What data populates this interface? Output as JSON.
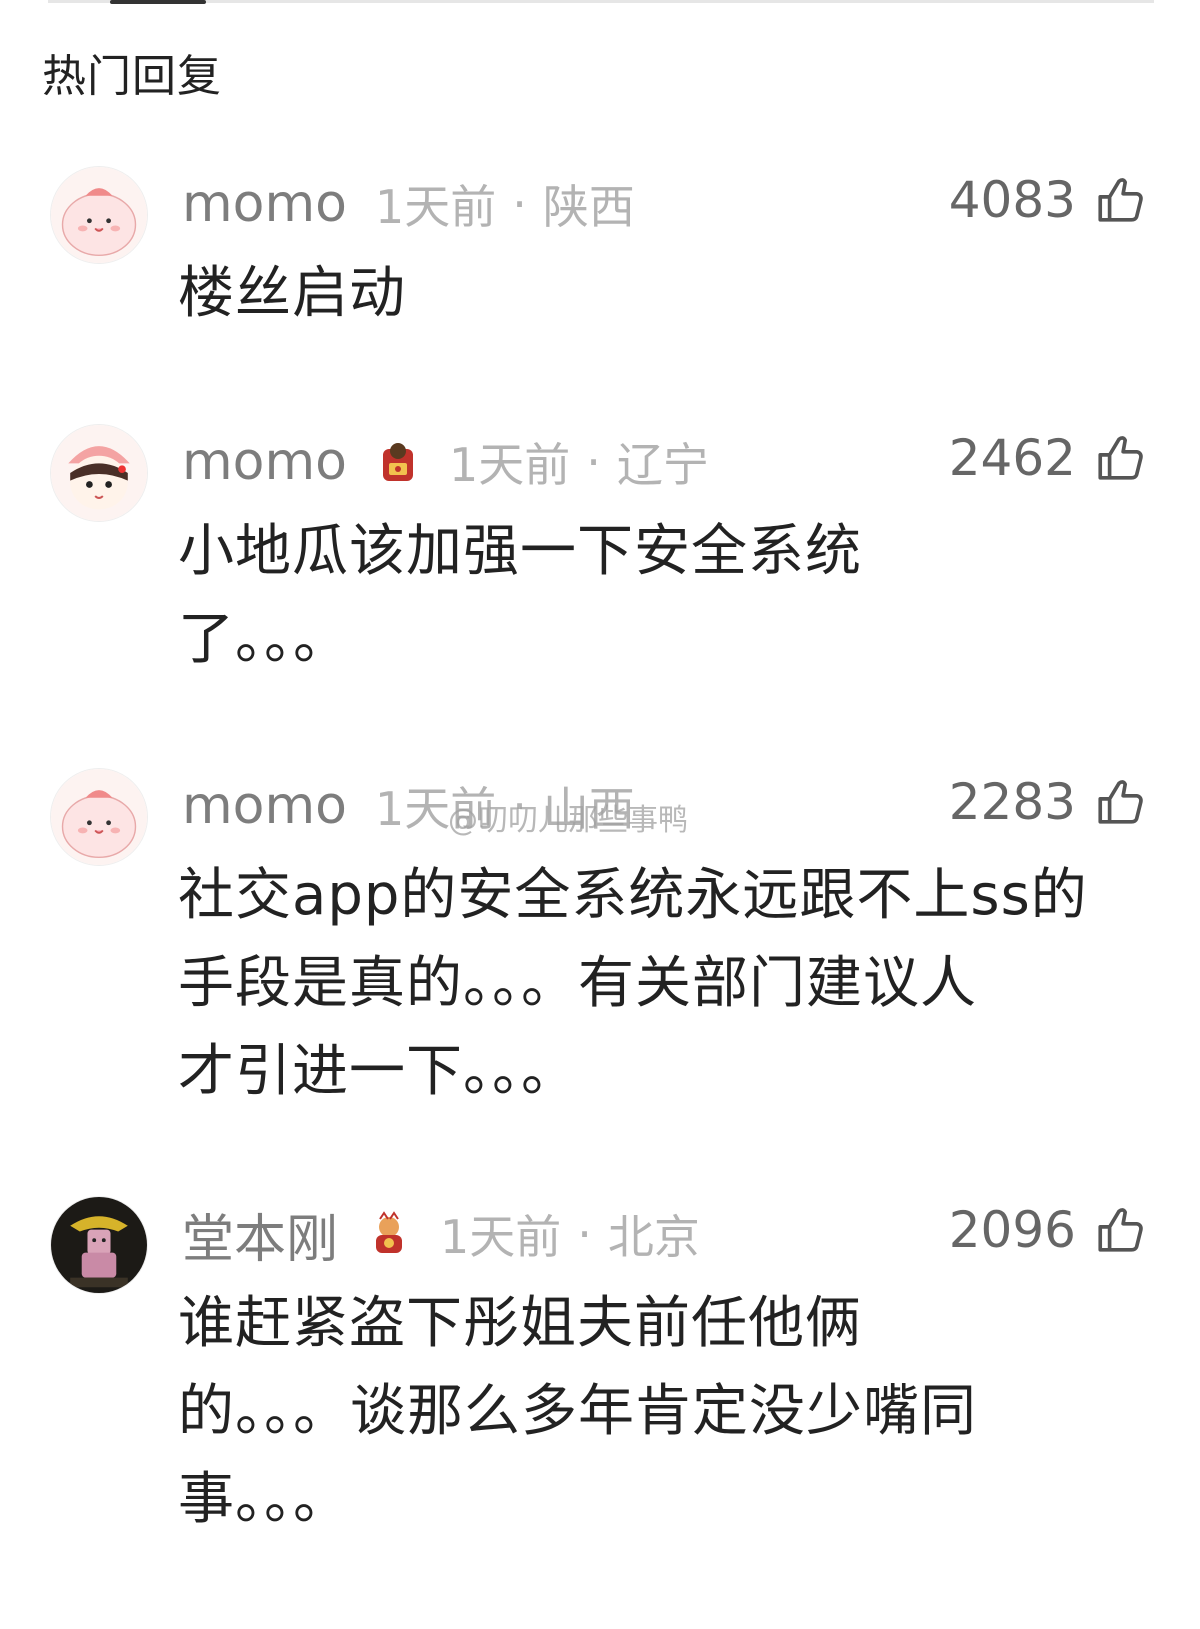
{
  "section_title": "热门回复",
  "watermark": "@叨叨儿那些事鸭",
  "comments": [
    {
      "username": "momo",
      "time": "1天前",
      "location": "陕西",
      "likes": "4083",
      "has_badge": false,
      "lines": [
        "楼丝启动"
      ],
      "avatar": "pink-blob-avatar"
    },
    {
      "username": "momo",
      "time": "1天前",
      "location": "辽宁",
      "likes": "2462",
      "has_badge": true,
      "lines": [
        "小地瓜该加强一下安全系统",
        "了。。。"
      ],
      "avatar": "girl-with-hat-avatar"
    },
    {
      "username": "momo",
      "time": "1天前",
      "location": "山西",
      "likes": "2283",
      "has_badge": false,
      "lines": [
        "社交app的安全系统永远跟不上ss的",
        "手段是真的。。。有关部门建议人",
        "才引进一下。。。"
      ],
      "avatar": "pink-blob-avatar"
    },
    {
      "username": "堂本刚",
      "time": "1天前",
      "location": "北京",
      "likes": "2096",
      "has_badge": true,
      "lines": [
        "谁赶紧盗下彤姐夫前任他俩",
        "的。。。谈那么多年肯定没少嘴同",
        "事。。。"
      ],
      "avatar": "dark-character-avatar"
    }
  ],
  "colors": {
    "username": "#7d7d7d",
    "meta": "#b3b3b3",
    "content": "#222222",
    "likes": "#666666"
  }
}
